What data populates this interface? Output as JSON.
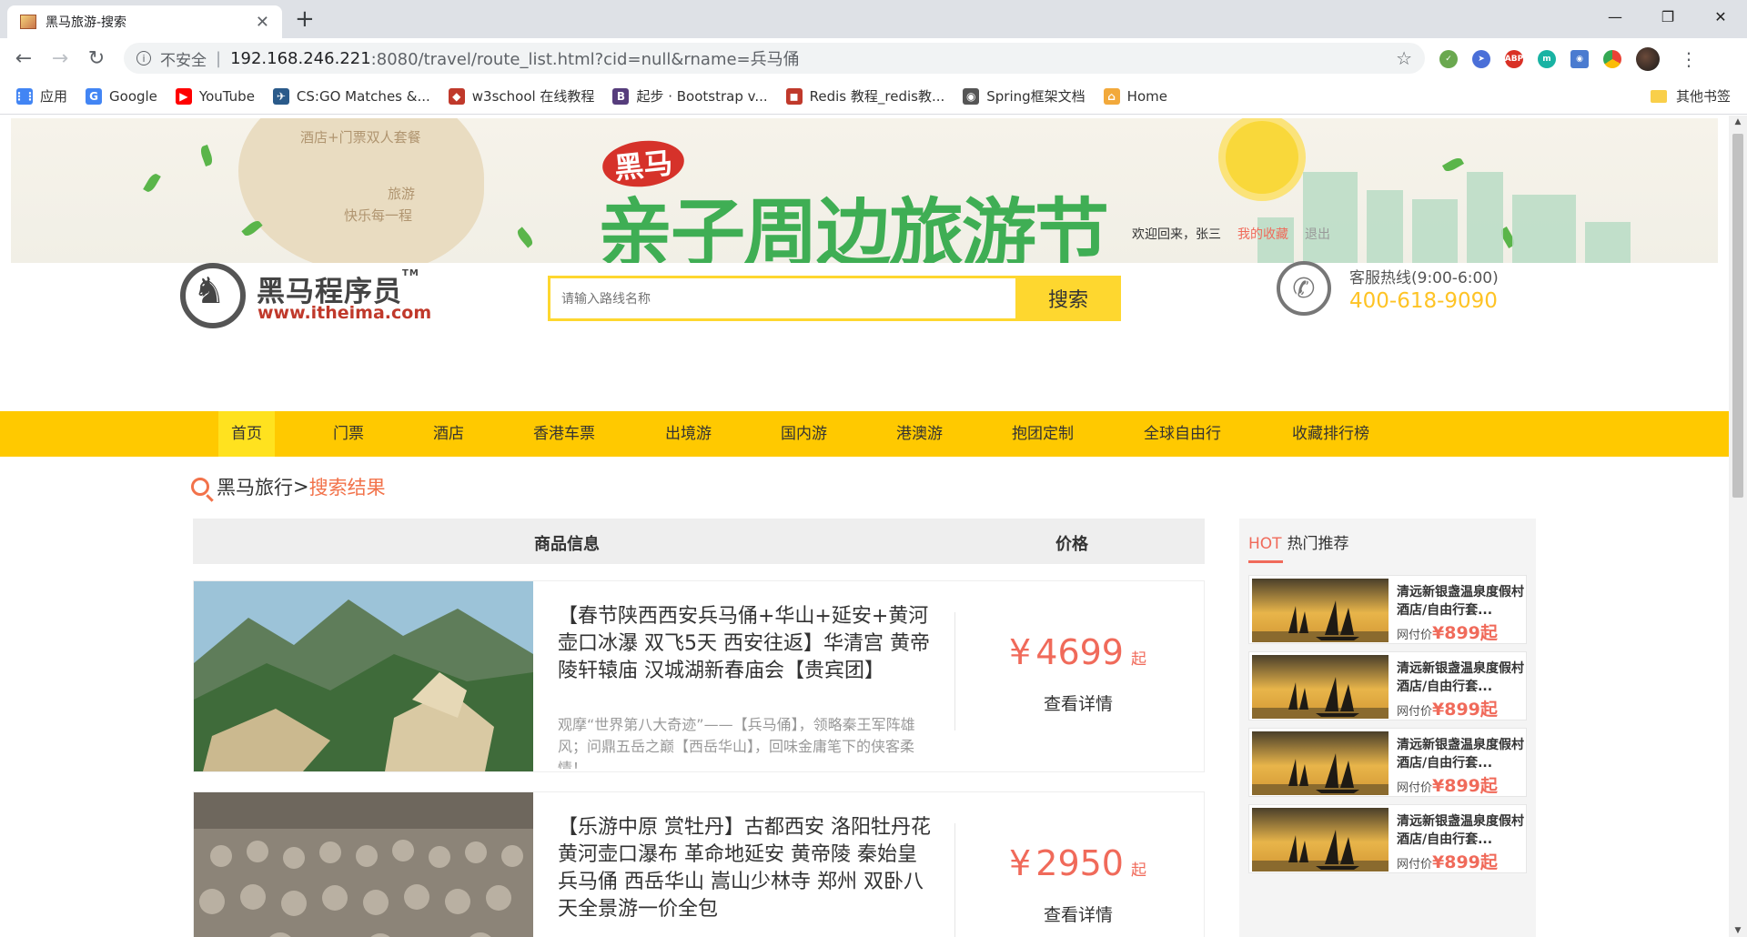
{
  "browser": {
    "tab_title": "黑马旅游-搜索",
    "new_tab": "+",
    "insecure_label": "不安全",
    "url_host": "192.168.246.221",
    "url_rest": ":8080/travel/route_list.html?cid=null&rname=兵马俑",
    "window_controls": [
      "—",
      "❐",
      "✕"
    ],
    "bookmarks": [
      {
        "label": "应用",
        "icon": "apps-grid-icon",
        "color": "#4285f4"
      },
      {
        "label": "Google",
        "icon": "google-icon",
        "color": "#4285f4"
      },
      {
        "label": "YouTube",
        "icon": "youtube-icon",
        "color": "#ff0000"
      },
      {
        "label": "CS:GO Matches &...",
        "icon": "csgo-icon",
        "color": "#2a5a8a"
      },
      {
        "label": "w3school 在线教程",
        "icon": "w3school-icon",
        "color": "#c0392b"
      },
      {
        "label": "起步 · Bootstrap v...",
        "icon": "bootstrap-icon",
        "color": "#563d7c"
      },
      {
        "label": "Redis 教程_redis教...",
        "icon": "redis-icon",
        "color": "#c0392b"
      },
      {
        "label": "Spring框架文档",
        "icon": "spring-icon",
        "color": "#555555"
      },
      {
        "label": "Home",
        "icon": "home-icon",
        "color": "#f2a93b"
      }
    ],
    "other_bookmarks": "其他书签"
  },
  "site": {
    "banner": {
      "badge": "黑马",
      "title": "亲子周边旅游节",
      "package_line1": "酒店+门票双人套餐",
      "package_line2": "旅游",
      "package_line3": "快乐每一程"
    },
    "user": {
      "welcome": "欢迎回来，张三",
      "favorites": "我的收藏",
      "logout": "退出"
    },
    "logo": {
      "name": "黑马程序员",
      "tm": "TM",
      "url": "www.itheima.com"
    },
    "search": {
      "placeholder": "请输入路线名称",
      "button": "搜索"
    },
    "hotline": {
      "title": "客服热线(9:00-6:00)",
      "number": "400-618-9090"
    },
    "nav": [
      "首页",
      "门票",
      "酒店",
      "香港车票",
      "出境游",
      "国内游",
      "港澳游",
      "抱团定制",
      "全球自由行",
      "收藏排行榜"
    ],
    "breadcrumb": {
      "home": "黑马旅行",
      "sep": ">",
      "current": "搜索结果"
    },
    "list_header": {
      "info": "商品信息",
      "price": "价格"
    },
    "routes": [
      {
        "title": "【春节陕西西安兵马俑+华山+延安+黄河壶口冰瀑 双飞5天 西安往返】华清宫 黄帝陵轩辕庙 汉城湖新春庙会【贵宾团】",
        "desc": "观摩“世界第八大奇迹”——【兵马俑】，领略秦王军阵雄风；问鼎五岳之巅【西岳华山】，回味金庸笔下的侠客柔情！",
        "currency": "¥",
        "price": "4699",
        "suffix": "起",
        "detail": "查看详情"
      },
      {
        "title": "【乐游中原 赏牡丹】古都西安 洛阳牡丹花 黄河壶口瀑布 革命地延安 黄帝陵 秦始皇兵马俑 西岳华山 嵩山少林寺 郑州 双卧八天全景游一价全包",
        "desc": "",
        "currency": "¥",
        "price": "2950",
        "suffix": "起",
        "detail": "查看详情"
      }
    ],
    "hot": {
      "label": "HOT",
      "title": "热门推荐",
      "items": [
        {
          "title": "清远新银盏温泉度假村酒店/自由行套...",
          "price_label": "网付价",
          "price": "¥899起"
        },
        {
          "title": "清远新银盏温泉度假村酒店/自由行套...",
          "price_label": "网付价",
          "price": "¥899起"
        },
        {
          "title": "清远新银盏温泉度假村酒店/自由行套...",
          "price_label": "网付价",
          "price": "¥899起"
        },
        {
          "title": "清远新银盏温泉度假村酒店/自由行套...",
          "price_label": "网付价",
          "price": "¥899起"
        }
      ]
    }
  },
  "colors": {
    "nav_bg": "#ffc900",
    "accent_red": "#f06a5a",
    "search_yellow": "#fed72f",
    "hotline_gold": "#fec325"
  }
}
